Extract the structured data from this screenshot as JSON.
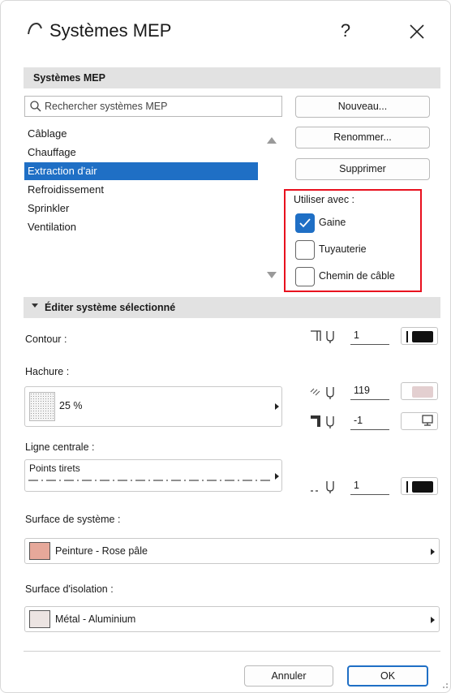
{
  "window": {
    "title": "Systèmes MEP",
    "help_label": "?",
    "icons": {
      "app": "archicad-arc-icon",
      "close": "close-icon"
    }
  },
  "section_systems": {
    "header": "Systèmes MEP",
    "search_placeholder": "Rechercher systèmes MEP",
    "items": [
      {
        "label": "Câblage",
        "selected": false
      },
      {
        "label": "Chauffage",
        "selected": false
      },
      {
        "label": "Extraction d'air",
        "selected": true
      },
      {
        "label": "Refroidissement",
        "selected": false
      },
      {
        "label": "Sprinkler",
        "selected": false
      },
      {
        "label": "Ventilation",
        "selected": false
      }
    ],
    "buttons": {
      "new": "Nouveau...",
      "rename": "Renommer...",
      "delete": "Supprimer"
    },
    "use_with": {
      "label": "Utiliser avec :",
      "options": [
        {
          "label": "Gaine",
          "checked": true
        },
        {
          "label": "Tuyauterie",
          "checked": false
        },
        {
          "label": "Chemin de câble",
          "checked": false
        }
      ]
    }
  },
  "section_edit": {
    "header": "Éditer système sélectionné",
    "contour": {
      "label": "Contour :",
      "pen": "1",
      "color": "#111111"
    },
    "hatch": {
      "label": "Hachure :",
      "value": "25 %",
      "fg_pen": "119",
      "fg_color": "#e3cfd0",
      "bg_pen": "-1"
    },
    "centerline": {
      "label": "Ligne centrale :",
      "value": "Points tirets",
      "pen": "1",
      "color": "#111111"
    },
    "system_surface": {
      "label": "Surface de système :",
      "value": "Peinture - Rose pâle",
      "color": "#e6a89a"
    },
    "insulation_surface": {
      "label": "Surface d'isolation :",
      "value": "Métal - Aluminium",
      "color": "#ece4e2"
    }
  },
  "footer": {
    "cancel": "Annuler",
    "ok": "OK"
  }
}
